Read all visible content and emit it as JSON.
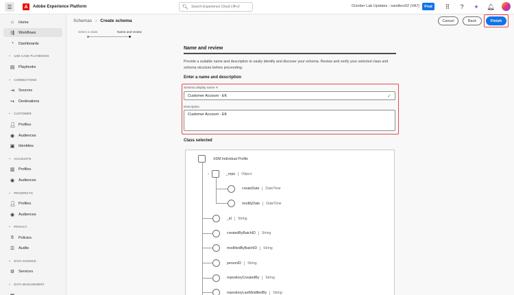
{
  "topbar": {
    "app_title": "Adobe Experience Platform",
    "search_placeholder": "Search Experience Cloud (⌘+/)",
    "sandbox": "October Lab Updates - sandbox02 (VA7)",
    "env_badge": "Prod",
    "icons": [
      "apps-grid-icon",
      "help-icon",
      "announcements-icon",
      "notifications-icon",
      "user-avatar"
    ]
  },
  "sidebar": {
    "top_items": [
      {
        "label": "Home",
        "icon": "home-icon",
        "active": false
      },
      {
        "label": "Workflows",
        "icon": "workflows-icon",
        "active": true
      },
      {
        "label": "Dashboards",
        "icon": "dashboards-icon",
        "active": false
      }
    ],
    "sections": [
      {
        "title": "USE CASE PLAYBOOKS",
        "items": [
          {
            "label": "Playbooks",
            "icon": "playbooks-icon"
          }
        ]
      },
      {
        "title": "CONNECTIONS",
        "items": [
          {
            "label": "Sources",
            "icon": "sources-icon"
          },
          {
            "label": "Destinations",
            "icon": "destinations-icon"
          }
        ]
      },
      {
        "title": "CUSTOMER",
        "items": [
          {
            "label": "Profiles",
            "icon": "profile-icon"
          },
          {
            "label": "Audiences",
            "icon": "audiences-icon"
          },
          {
            "label": "Identities",
            "icon": "identities-icon"
          }
        ]
      },
      {
        "title": "ACCOUNTS",
        "items": [
          {
            "label": "Profiles",
            "icon": "account-profiles-icon"
          },
          {
            "label": "Audiences",
            "icon": "audiences-icon"
          }
        ]
      },
      {
        "title": "PROSPECTS",
        "items": [
          {
            "label": "Profiles",
            "icon": "profile-icon"
          },
          {
            "label": "Audiences",
            "icon": "audiences-icon"
          }
        ]
      },
      {
        "title": "PRIVACY",
        "items": [
          {
            "label": "Policies",
            "icon": "policies-icon"
          },
          {
            "label": "Audits",
            "icon": "audits-icon"
          }
        ]
      },
      {
        "title": "DATA SCIENCE",
        "items": [
          {
            "label": "Services",
            "icon": "services-icon"
          }
        ]
      },
      {
        "title": "DATA MANAGEMENT",
        "items": []
      }
    ]
  },
  "breadcrumb": {
    "parent": "Schemas",
    "current": "Create schema"
  },
  "stepper": {
    "steps": [
      "Select a class",
      "Name and review"
    ],
    "current": 1
  },
  "actions": {
    "cancel": "Cancel",
    "back": "Back",
    "finish": "Finish"
  },
  "form": {
    "title": "Name and review",
    "description": "Provide a suitable name and description to easily identify and discover your schema. Review and verify your selected class and schema structure before proceeding.",
    "subtitle": "Enter a name and description",
    "name_label": "Schema display name ✳",
    "name_value": "Customer Account - EK",
    "description_label": "Description",
    "description_value": "Customer Account - EK"
  },
  "class_section": {
    "title": "Class selected",
    "root": "XDM Individual Profile",
    "fields": [
      {
        "name": "_repo",
        "type": "Object",
        "level": 1,
        "kind": "object"
      },
      {
        "name": "createDate",
        "type": "DateTime",
        "level": 2,
        "kind": "field"
      },
      {
        "name": "modifyDate",
        "type": "DateTime",
        "level": 2,
        "kind": "field"
      },
      {
        "name": "_id",
        "type": "String",
        "level": 1,
        "kind": "field"
      },
      {
        "name": "createdByBatchID",
        "type": "String",
        "level": 1,
        "kind": "field"
      },
      {
        "name": "modifiedByBatchID",
        "type": "String",
        "level": 1,
        "kind": "field"
      },
      {
        "name": "personID",
        "type": "String",
        "level": 1,
        "kind": "field"
      },
      {
        "name": "repositoryCreatedBy",
        "type": "String",
        "level": 1,
        "kind": "field"
      },
      {
        "name": "repositoryLastModifiedBy",
        "type": "String",
        "level": 1,
        "kind": "field"
      }
    ]
  }
}
